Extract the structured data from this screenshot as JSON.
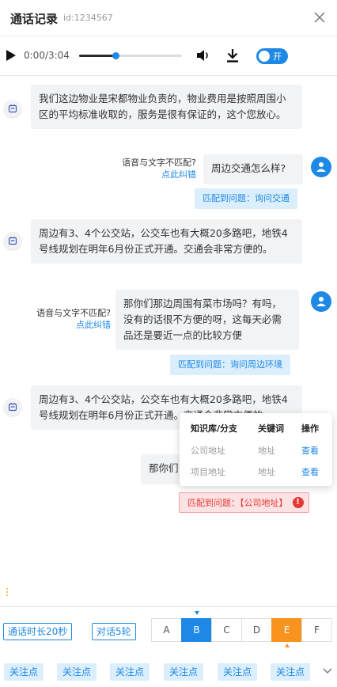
{
  "header": {
    "title": "通话记录",
    "uid": "id:1234567"
  },
  "player": {
    "time": "0:00/3:04",
    "progress": 0.35,
    "toggle_label": "开",
    "toggle_on": true
  },
  "messages": [
    {
      "role": "bot",
      "text": "我们这边物业是宋都物业负责的，物业费用是按照周围小区的平均标准收取的，服务是很有保证的，这个您放心。"
    },
    {
      "role": "user",
      "text": "周边交通怎么样?",
      "mismatch": "语音与文字不匹配?",
      "fix": "点此纠错",
      "match": "匹配到问题：询问交通"
    },
    {
      "role": "bot",
      "text": "周边有3、4个公交站，公交车也有大概20多路吧，地铁4号线规划在明年6月份正式开通。交通会非常方便的。"
    },
    {
      "role": "user",
      "text": "那你们那边周围有菜市场吗？有吗，没有的话很不方便的呀，这每天必需品还是要近一点的比较方便",
      "mismatch": "语音与文字不匹配?",
      "fix": "点此纠错",
      "match": "匹配到问题：询问周边环境"
    },
    {
      "role": "bot",
      "text": "周边有3、4个公交站，公交车也有大概20多路吧，地铁4号线规划在明年6月份正式开通。交通会非常方便的。"
    },
    {
      "role": "user",
      "text": "那你们",
      "match": "匹配到问题：【公司地址】"
    }
  ],
  "popover": {
    "headers": [
      "知识库/分支",
      "关键词",
      "操作"
    ],
    "rows": [
      [
        "公司地址",
        "地址",
        "查看"
      ],
      [
        "项目地址",
        "地址",
        "查看"
      ]
    ]
  },
  "stats": {
    "duration": "通话时长20秒",
    "turns": "对话5轮"
  },
  "options": [
    "A",
    "B",
    "C",
    "D",
    "E",
    "F"
  ],
  "selected_option": "B",
  "warning_option": "E",
  "focus_points": [
    "关注点",
    "关注点",
    "关注点",
    "关注点",
    "关注点",
    "关注点"
  ],
  "colors": {
    "accent": "#1e88e5",
    "warning": "#f7931e",
    "error": "#e53935"
  }
}
